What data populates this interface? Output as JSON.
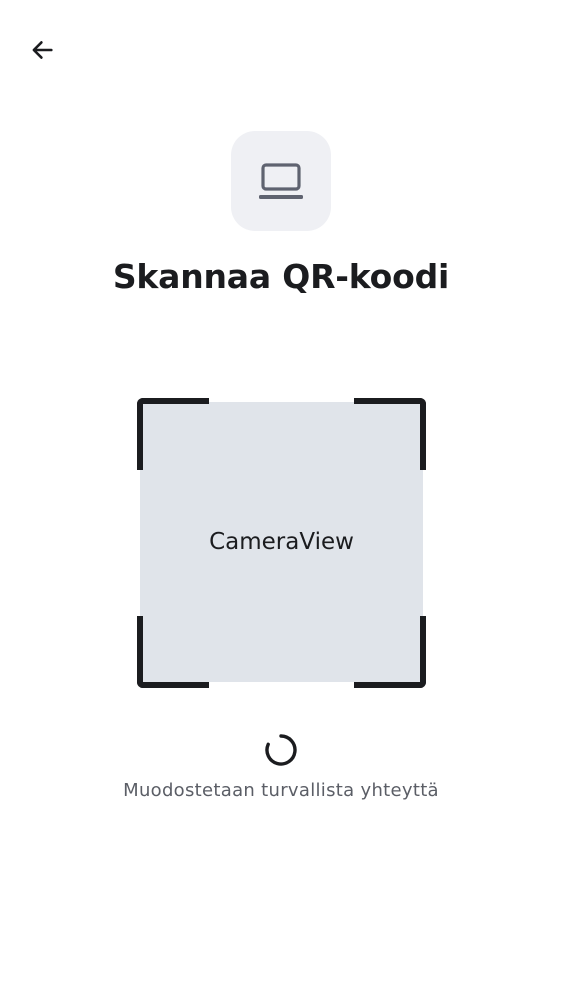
{
  "header": {
    "back_icon": "arrow-left-icon"
  },
  "device": {
    "icon": "laptop-icon",
    "tile_color": "#eff0f4"
  },
  "title": "Skannaa QR-koodi",
  "scanner": {
    "camera_label": "CameraView",
    "frame_color": "#1b1c1f",
    "camera_bg": "#e0e4ea"
  },
  "status": {
    "spinner_icon": "loading-spinner-icon",
    "message": "Muodostetaan turvallista yhteyttä"
  }
}
